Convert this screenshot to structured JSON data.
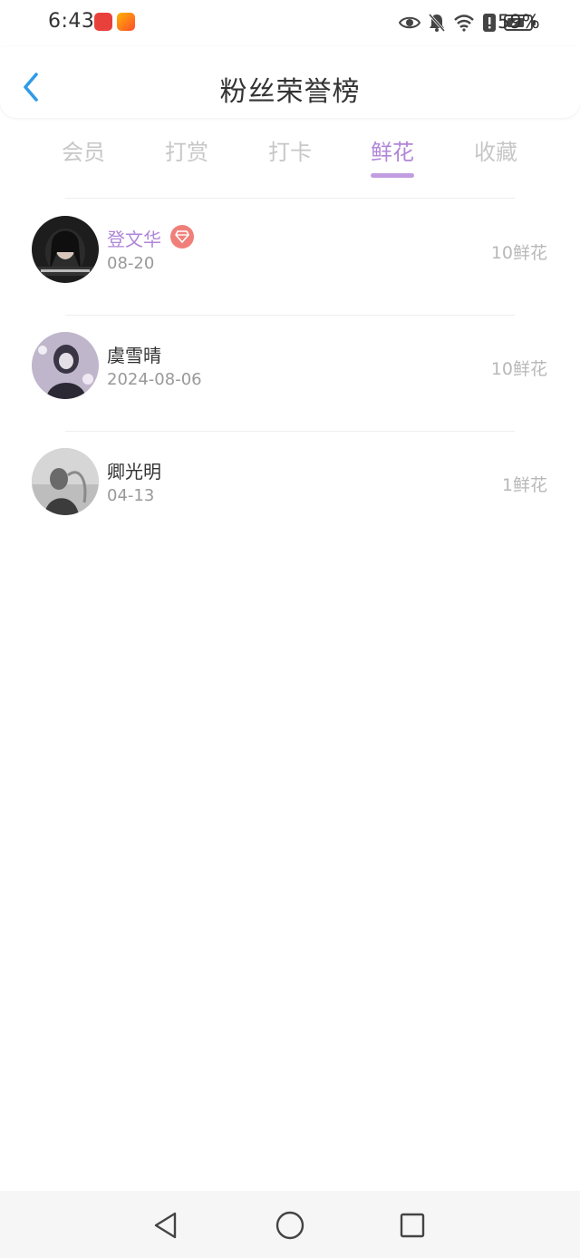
{
  "status_bar": {
    "time": "6:43",
    "battery_percent": "59%",
    "icons": [
      "app-icon-1",
      "app-icon-2",
      "eye-icon",
      "mute-bell-icon",
      "wifi-icon",
      "alert-icon",
      "battery-icon"
    ]
  },
  "header": {
    "title": "粉丝荣誉榜",
    "back_icon": "chevron-left-icon"
  },
  "tabs": [
    {
      "label": "会员",
      "active": false
    },
    {
      "label": "打赏",
      "active": false
    },
    {
      "label": "打卡",
      "active": false
    },
    {
      "label": "鲜花",
      "active": true
    },
    {
      "label": "收藏",
      "active": false
    }
  ],
  "list": [
    {
      "name": "登文华",
      "date": "08-20",
      "amount": "10鲜花",
      "vip": true
    },
    {
      "name": "虞雪晴",
      "date": "2024-08-06",
      "amount": "10鲜花",
      "vip": false
    },
    {
      "name": "卿光明",
      "date": "04-13",
      "amount": "1鲜花",
      "vip": false
    }
  ],
  "colors": {
    "accent": "#b086d8",
    "back_arrow": "#2f9be8",
    "vip_badge": "#f07f7a",
    "inactive_tab": "#c7c7c7"
  },
  "navbar": {
    "icons": [
      "back-triangle-icon",
      "home-circle-icon",
      "recents-square-icon"
    ]
  }
}
